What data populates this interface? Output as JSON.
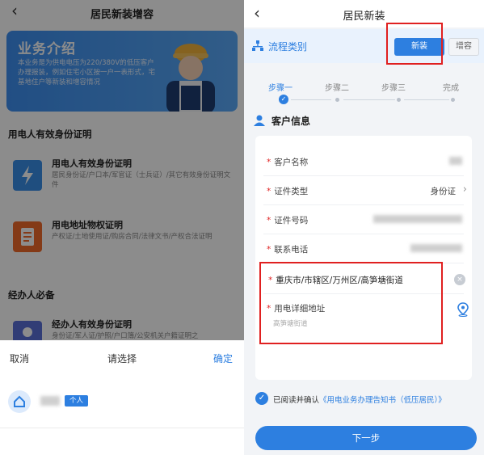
{
  "left": {
    "header_title": "居民新装增容",
    "banner": {
      "title": "业务介绍",
      "desc": "本业务是为供电电压为220/380V的低压客户办理报装，例如住宅小区按一户一表形式，宅基地住户等新装和增容情况"
    },
    "section1_title": "用电人有效身份证明",
    "card1": {
      "title": "用电人有效身份证明",
      "desc": "居民身份证/户口本/军官证（士兵证）/其它有效身份证明文件",
      "icon": "lightning-icon"
    },
    "card2": {
      "title": "用电地址物权证明",
      "desc": "产权证/土地使用证/购房合同/法律文书/产权合法证明",
      "icon": "document-icon"
    },
    "section2_title": "经办人必备",
    "card3": {
      "title": "经办人有效身份证明",
      "desc": "身份证/军人证/护照/户口簿/公安机关户籍证明之",
      "icon": "person-icon"
    },
    "sheet": {
      "cancel": "取消",
      "title": "请选择",
      "confirm": "确定",
      "tag": "个人"
    }
  },
  "right": {
    "header_title": "居民新装",
    "flow_label": "流程类别",
    "btn_new": "新装",
    "btn_expand": "增容",
    "steps": [
      "步骤一",
      "步骤二",
      "步骤三",
      "完成"
    ],
    "section_title": "客户信息",
    "fields": {
      "name_label": "客户名称",
      "id_type_label": "证件类型",
      "id_type_value": "身份证",
      "id_no_label": "证件号码",
      "phone_label": "联系电话",
      "address_region": "重庆市/市辖区/万州区/高笋塘街道",
      "detail_label": "用电详细地址",
      "detail_value": "高笋塘街道"
    },
    "agree_prefix": "已阅读并确认",
    "agree_link": "《用电业务办理告知书（低压居民）》",
    "next": "下一步"
  },
  "colors": {
    "accent": "#2d7fe0",
    "highlight": "#e02020",
    "required": "#e02020"
  }
}
